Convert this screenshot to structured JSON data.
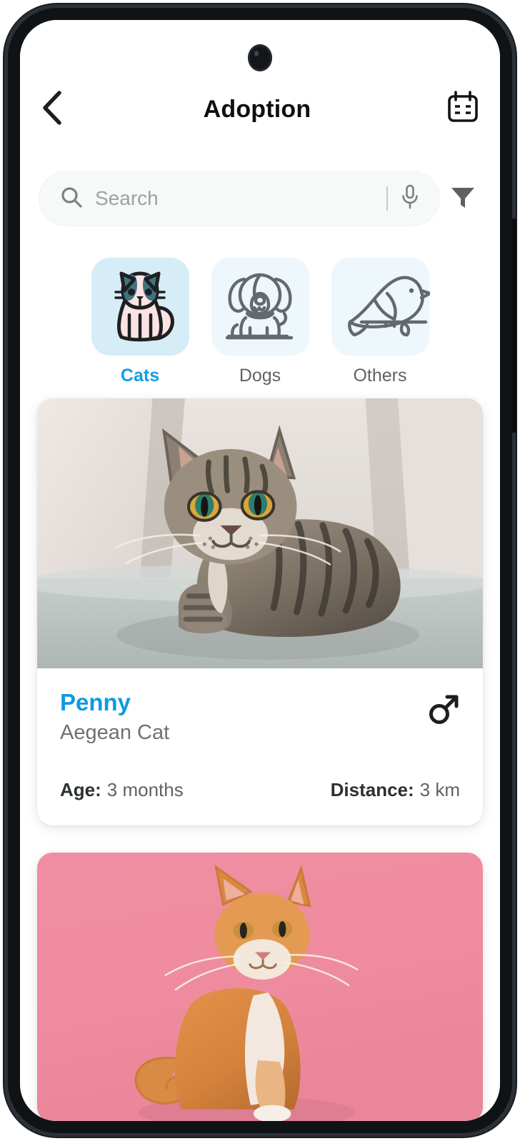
{
  "app": {
    "header": {
      "title": "Adoption",
      "back_icon": "chevron-left-icon",
      "calendar_icon": "calendar-icon"
    },
    "search": {
      "placeholder": "Search",
      "value": "",
      "search_icon": "search-icon",
      "mic_icon": "microphone-icon",
      "filter_icon": "filter-funnel-icon"
    },
    "categories": {
      "selected": "Cats",
      "accent_color": "#169ee0",
      "items": [
        {
          "label": "Cats",
          "icon": "cat-icon",
          "tile_color": "#d6ecf7",
          "selected": true
        },
        {
          "label": "Dogs",
          "icon": "dog-icon",
          "tile_color": "#eef7fb",
          "selected": false
        },
        {
          "label": "Others",
          "icon": "bird-icon",
          "tile_color": "#eef7fb",
          "selected": false
        }
      ]
    },
    "pets": [
      {
        "name": "Penny",
        "breed": "Aegean Cat",
        "gender": "male",
        "gender_icon": "male-symbol-icon",
        "age_label": "Age:",
        "age_value": "3 months",
        "distance_label": "Distance:",
        "distance_value": "3 km",
        "photo": "tabby-cat-on-grey-couch"
      },
      {
        "photo": "orange-long-haired-cat-on-pink-background"
      }
    ]
  }
}
